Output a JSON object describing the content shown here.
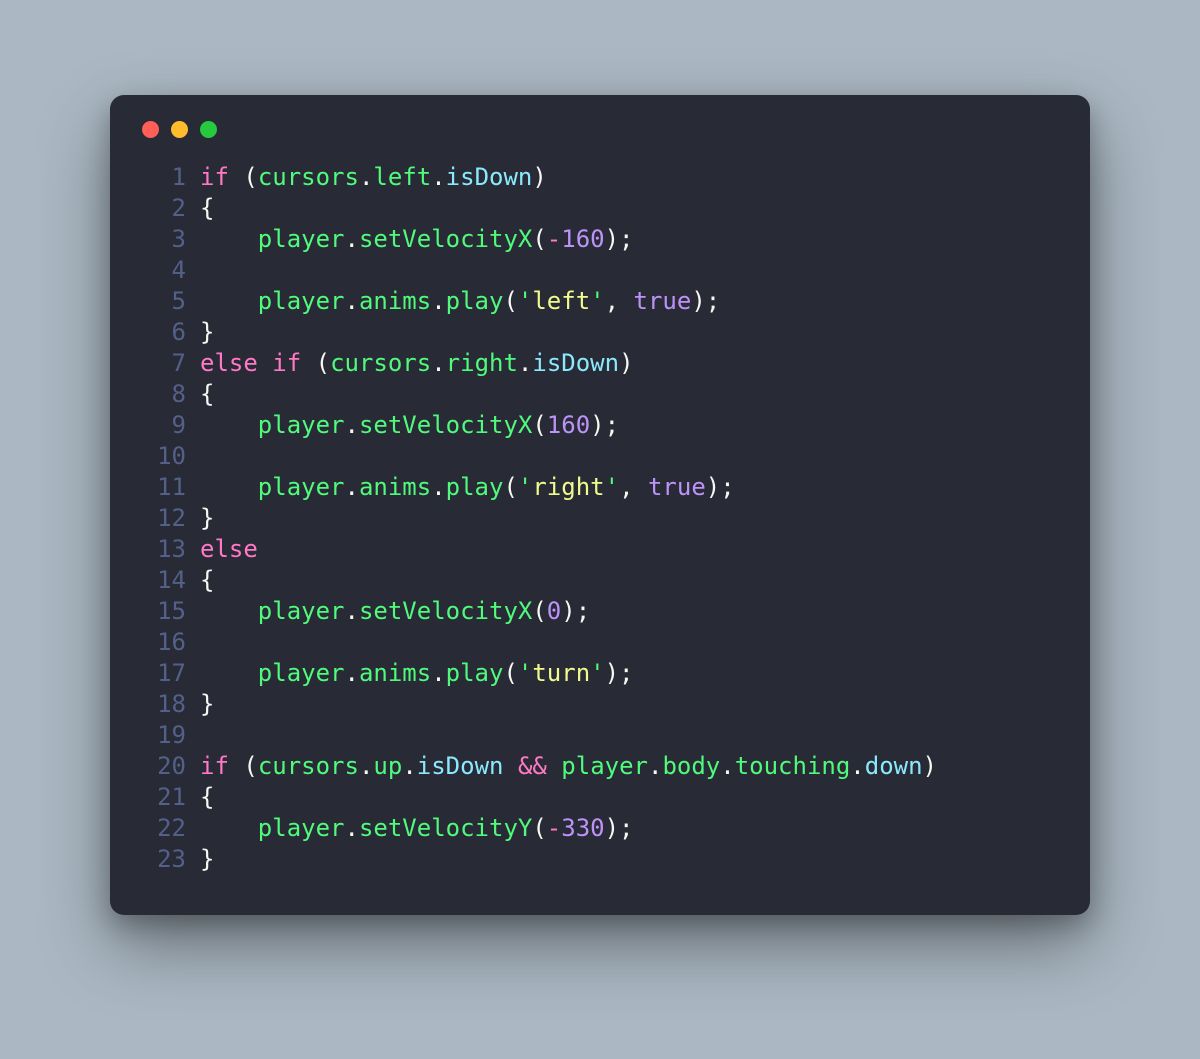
{
  "window": {
    "traffic_lights": [
      "red",
      "yellow",
      "green"
    ]
  },
  "colors": {
    "background_page": "#abb8c3",
    "background_window": "#282a36",
    "line_number": "#6272a4",
    "default": "#f8f8f2",
    "keyword": "#ff79c6",
    "identifier": "#50fa7b",
    "property": "#8be9fd",
    "number": "#bd93f9",
    "boolean": "#bd93f9",
    "string": "#f1fa8c"
  },
  "code": {
    "language": "javascript",
    "lines": [
      {
        "n": 1,
        "tokens": [
          [
            "kw",
            "if"
          ],
          [
            "punc",
            " ("
          ],
          [
            "ident",
            "cursors"
          ],
          [
            "punc",
            "."
          ],
          [
            "ident",
            "left"
          ],
          [
            "punc",
            "."
          ],
          [
            "obj",
            "isDown"
          ],
          [
            "punc",
            ")"
          ]
        ]
      },
      {
        "n": 2,
        "tokens": [
          [
            "punc",
            "{"
          ]
        ]
      },
      {
        "n": 3,
        "tokens": [
          [
            "punc",
            "    "
          ],
          [
            "ident",
            "player"
          ],
          [
            "punc",
            "."
          ],
          [
            "ident",
            "setVelocityX"
          ],
          [
            "punc",
            "("
          ],
          [
            "kw",
            "-"
          ],
          [
            "num",
            "160"
          ],
          [
            "punc",
            ");"
          ]
        ]
      },
      {
        "n": 4,
        "tokens": []
      },
      {
        "n": 5,
        "tokens": [
          [
            "punc",
            "    "
          ],
          [
            "ident",
            "player"
          ],
          [
            "punc",
            "."
          ],
          [
            "ident",
            "anims"
          ],
          [
            "punc",
            "."
          ],
          [
            "ident",
            "play"
          ],
          [
            "punc",
            "("
          ],
          [
            "strq",
            "'"
          ],
          [
            "str",
            "left"
          ],
          [
            "strq",
            "'"
          ],
          [
            "punc",
            ", "
          ],
          [
            "bool",
            "true"
          ],
          [
            "punc",
            ");"
          ]
        ]
      },
      {
        "n": 6,
        "tokens": [
          [
            "punc",
            "}"
          ]
        ]
      },
      {
        "n": 7,
        "tokens": [
          [
            "kw",
            "else"
          ],
          [
            "punc",
            " "
          ],
          [
            "kw",
            "if"
          ],
          [
            "punc",
            " ("
          ],
          [
            "ident",
            "cursors"
          ],
          [
            "punc",
            "."
          ],
          [
            "ident",
            "right"
          ],
          [
            "punc",
            "."
          ],
          [
            "obj",
            "isDown"
          ],
          [
            "punc",
            ")"
          ]
        ]
      },
      {
        "n": 8,
        "tokens": [
          [
            "punc",
            "{"
          ]
        ]
      },
      {
        "n": 9,
        "tokens": [
          [
            "punc",
            "    "
          ],
          [
            "ident",
            "player"
          ],
          [
            "punc",
            "."
          ],
          [
            "ident",
            "setVelocityX"
          ],
          [
            "punc",
            "("
          ],
          [
            "num",
            "160"
          ],
          [
            "punc",
            ");"
          ]
        ]
      },
      {
        "n": 10,
        "tokens": []
      },
      {
        "n": 11,
        "tokens": [
          [
            "punc",
            "    "
          ],
          [
            "ident",
            "player"
          ],
          [
            "punc",
            "."
          ],
          [
            "ident",
            "anims"
          ],
          [
            "punc",
            "."
          ],
          [
            "ident",
            "play"
          ],
          [
            "punc",
            "("
          ],
          [
            "strq",
            "'"
          ],
          [
            "str",
            "right"
          ],
          [
            "strq",
            "'"
          ],
          [
            "punc",
            ", "
          ],
          [
            "bool",
            "true"
          ],
          [
            "punc",
            ");"
          ]
        ]
      },
      {
        "n": 12,
        "tokens": [
          [
            "punc",
            "}"
          ]
        ]
      },
      {
        "n": 13,
        "tokens": [
          [
            "kw",
            "else"
          ]
        ]
      },
      {
        "n": 14,
        "tokens": [
          [
            "punc",
            "{"
          ]
        ]
      },
      {
        "n": 15,
        "tokens": [
          [
            "punc",
            "    "
          ],
          [
            "ident",
            "player"
          ],
          [
            "punc",
            "."
          ],
          [
            "ident",
            "setVelocityX"
          ],
          [
            "punc",
            "("
          ],
          [
            "num",
            "0"
          ],
          [
            "punc",
            ");"
          ]
        ]
      },
      {
        "n": 16,
        "tokens": []
      },
      {
        "n": 17,
        "tokens": [
          [
            "punc",
            "    "
          ],
          [
            "ident",
            "player"
          ],
          [
            "punc",
            "."
          ],
          [
            "ident",
            "anims"
          ],
          [
            "punc",
            "."
          ],
          [
            "ident",
            "play"
          ],
          [
            "punc",
            "("
          ],
          [
            "strq",
            "'"
          ],
          [
            "str",
            "turn"
          ],
          [
            "strq",
            "'"
          ],
          [
            "punc",
            ");"
          ]
        ]
      },
      {
        "n": 18,
        "tokens": [
          [
            "punc",
            "}"
          ]
        ]
      },
      {
        "n": 19,
        "tokens": []
      },
      {
        "n": 20,
        "tokens": [
          [
            "kw",
            "if"
          ],
          [
            "punc",
            " ("
          ],
          [
            "ident",
            "cursors"
          ],
          [
            "punc",
            "."
          ],
          [
            "ident",
            "up"
          ],
          [
            "punc",
            "."
          ],
          [
            "obj",
            "isDown"
          ],
          [
            "punc",
            " "
          ],
          [
            "kw",
            "&&"
          ],
          [
            "punc",
            " "
          ],
          [
            "ident",
            "player"
          ],
          [
            "punc",
            "."
          ],
          [
            "ident",
            "body"
          ],
          [
            "punc",
            "."
          ],
          [
            "ident",
            "touching"
          ],
          [
            "punc",
            "."
          ],
          [
            "obj",
            "down"
          ],
          [
            "punc",
            ")"
          ]
        ]
      },
      {
        "n": 21,
        "tokens": [
          [
            "punc",
            "{"
          ]
        ]
      },
      {
        "n": 22,
        "tokens": [
          [
            "punc",
            "    "
          ],
          [
            "ident",
            "player"
          ],
          [
            "punc",
            "."
          ],
          [
            "ident",
            "setVelocityY"
          ],
          [
            "punc",
            "("
          ],
          [
            "kw",
            "-"
          ],
          [
            "num",
            "330"
          ],
          [
            "punc",
            ");"
          ]
        ]
      },
      {
        "n": 23,
        "tokens": [
          [
            "punc",
            "}"
          ]
        ]
      }
    ]
  }
}
